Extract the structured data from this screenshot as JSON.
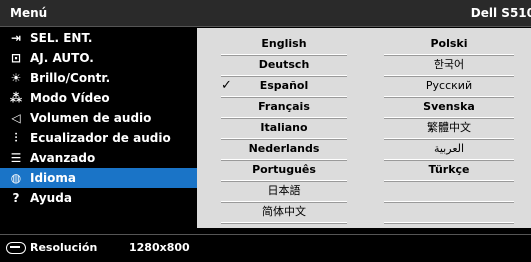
{
  "header": {
    "menu_title": "Menú",
    "model": "Dell S510"
  },
  "sidebar": {
    "items": [
      {
        "label": "SEL. ENT.",
        "icon": "⇥"
      },
      {
        "label": "AJ. AUTO.",
        "icon": "⊡"
      },
      {
        "label": "Brillo/Contr.",
        "icon": "☀"
      },
      {
        "label": "Modo Vídeo",
        "icon": "⁂"
      },
      {
        "label": "Volumen de audio",
        "icon": "◁"
      },
      {
        "label": "Ecualizador de audio",
        "icon": "⫶"
      },
      {
        "label": "Avanzado",
        "icon": "☰"
      },
      {
        "label": "Idioma",
        "icon": "◍"
      },
      {
        "label": "Ayuda",
        "icon": "?"
      }
    ],
    "selected": "Idioma"
  },
  "languages": {
    "column1": [
      "English",
      "Deutsch",
      "Español",
      "Français",
      "Italiano",
      "Nederlands",
      "Português",
      "日本語",
      "简体中文"
    ],
    "column2": [
      "Polski",
      "한국어",
      "Русский",
      "Svenska",
      "繁體中文",
      "العربية",
      "Türkçe",
      "",
      ""
    ],
    "selected": "Español",
    "check_glyph": "✓"
  },
  "footer": {
    "resolution_label": "Resolución",
    "resolution_value": "1280x800"
  },
  "colors": {
    "highlight": "#1a74c7",
    "panel": "#dcdcdc",
    "background": "#000000"
  }
}
